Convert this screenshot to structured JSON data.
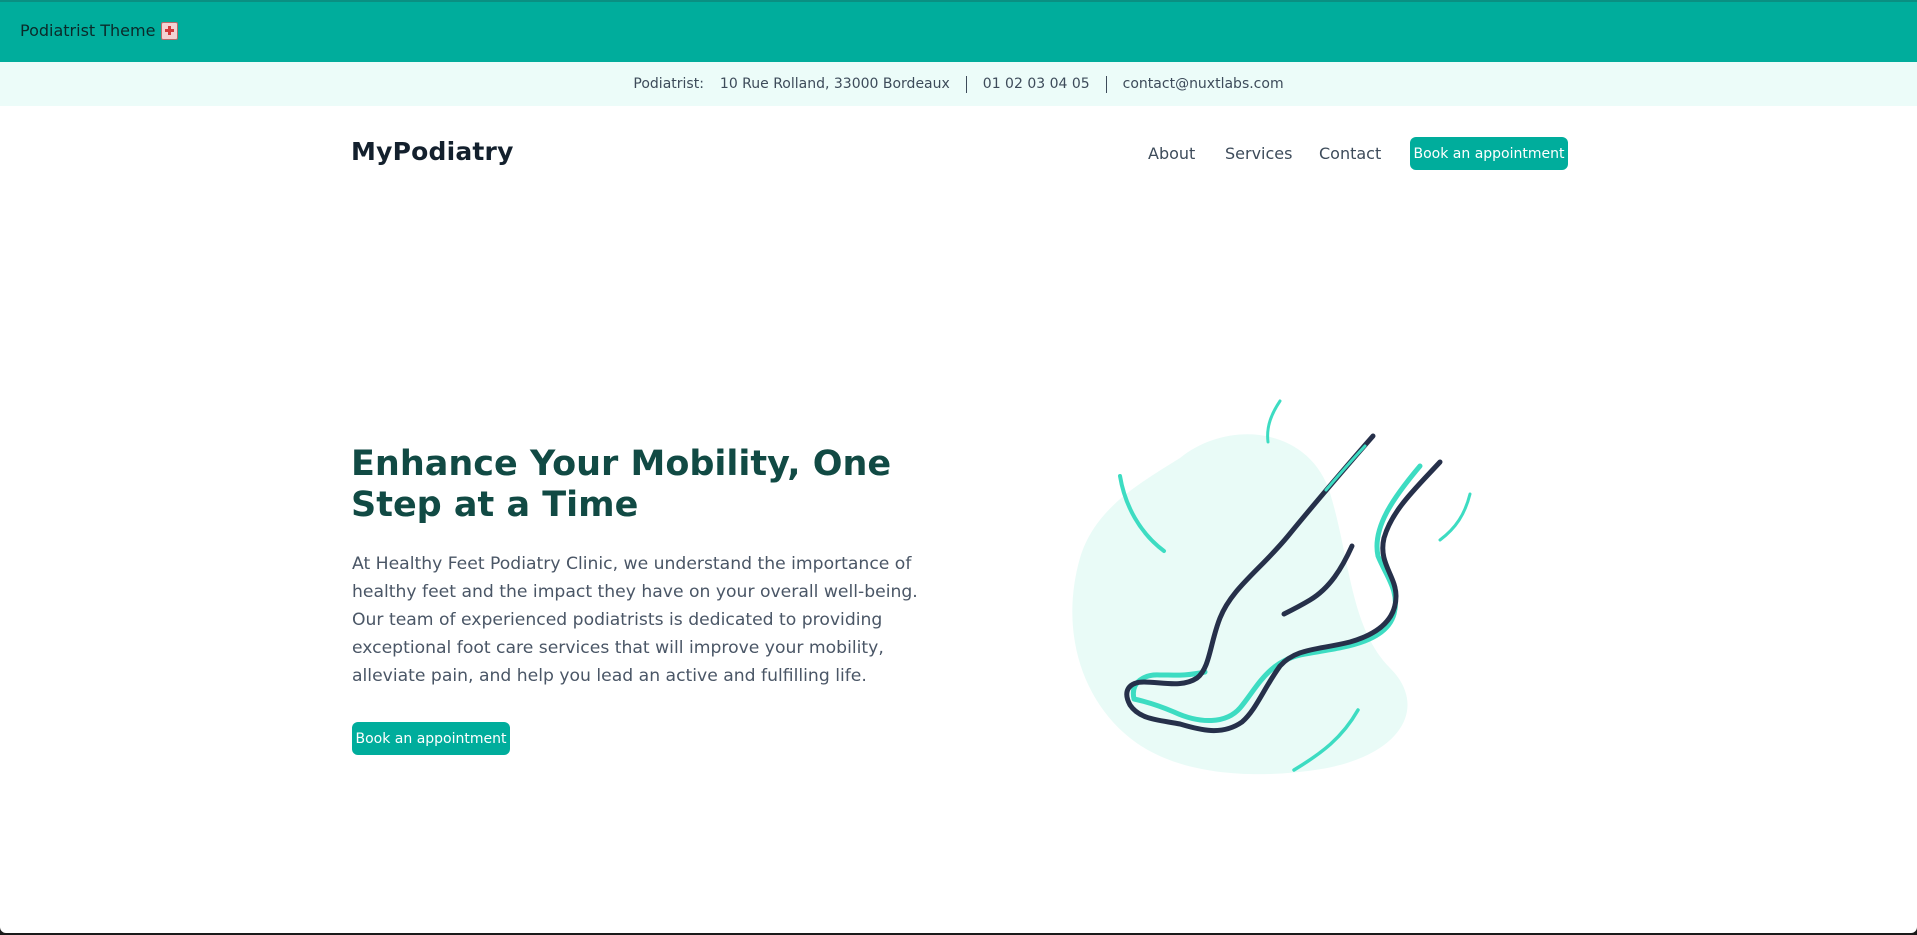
{
  "app": {
    "title": "Podiatrist Theme",
    "icon": "hospital-icon"
  },
  "infobar": {
    "label": "Podiatrist:",
    "address": "10 Rue Rolland, 33000 Bordeaux",
    "phone": "01 02 03 04 05",
    "email": "contact@nuxtlabs.com"
  },
  "nav": {
    "brand": "MyPodiatry",
    "links": [
      "About",
      "Services",
      "Contact"
    ],
    "cta": "Book an appointment"
  },
  "hero": {
    "title": "Enhance Your Mobility, One Step at a Time",
    "text": "At Healthy Feet Podiatry Clinic, we understand the importance of healthy feet and the impact they have on your overall well-being. Our team of experienced podiatrists is dedicated to providing exceptional foot care services that will improve your mobility, alleviate pain, and help you lead an active and fulfilling life.",
    "cta": "Book an appointment",
    "illustration": "feet-illustration"
  },
  "colors": {
    "primary": "#00ad9c",
    "infobar_bg": "#ecfcf9",
    "heading": "#114a44",
    "accent_line": "#3ddcc2",
    "dark_line": "#26304a",
    "blob": "#e9fbf7"
  }
}
